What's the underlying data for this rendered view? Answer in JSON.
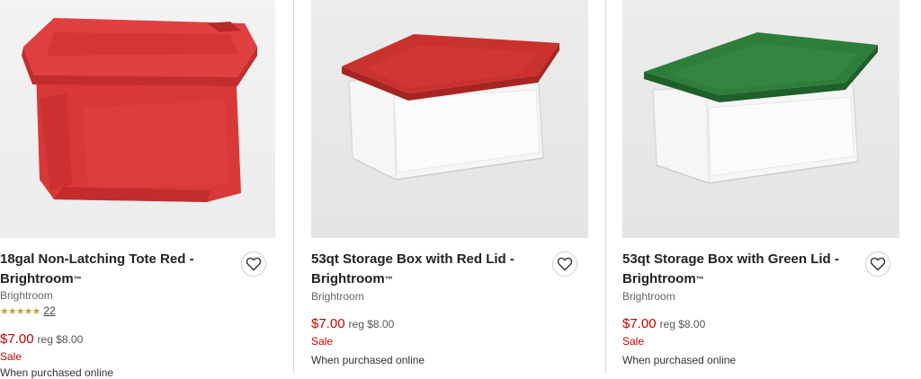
{
  "products": [
    {
      "title": "18gal Non-Latching Tote Red - Brightroom",
      "trademark": "™",
      "brand": "Brightroom",
      "rating_stars": "★★★★★",
      "review_count": "22",
      "price": "$7.00",
      "reg_price": "reg $8.00",
      "sale": "Sale",
      "online": "When purchased online",
      "favorite_icon": "heart-outline-icon",
      "lid_color": "#d63a3a",
      "body_color": "#d93a3a"
    },
    {
      "title": "53qt Storage Box with Red Lid - Brightroom",
      "trademark": "™",
      "brand": "Brightroom",
      "price": "$7.00",
      "reg_price": "reg $8.00",
      "sale": "Sale",
      "online": "When purchased online",
      "favorite_icon": "heart-outline-icon",
      "lid_color": "#c9312f"
    },
    {
      "title": "53qt Storage Box with Green Lid - Brightroom",
      "trademark": "™",
      "brand": "Brightroom",
      "price": "$7.00",
      "reg_price": "reg $8.00",
      "sale": "Sale",
      "online": "When purchased online",
      "favorite_icon": "heart-outline-icon",
      "lid_color": "#2f7d3a"
    }
  ],
  "colors": {
    "sale_red": "#cc0000",
    "star_gold": "#c9a13b",
    "divider": "#d6d6d6"
  }
}
